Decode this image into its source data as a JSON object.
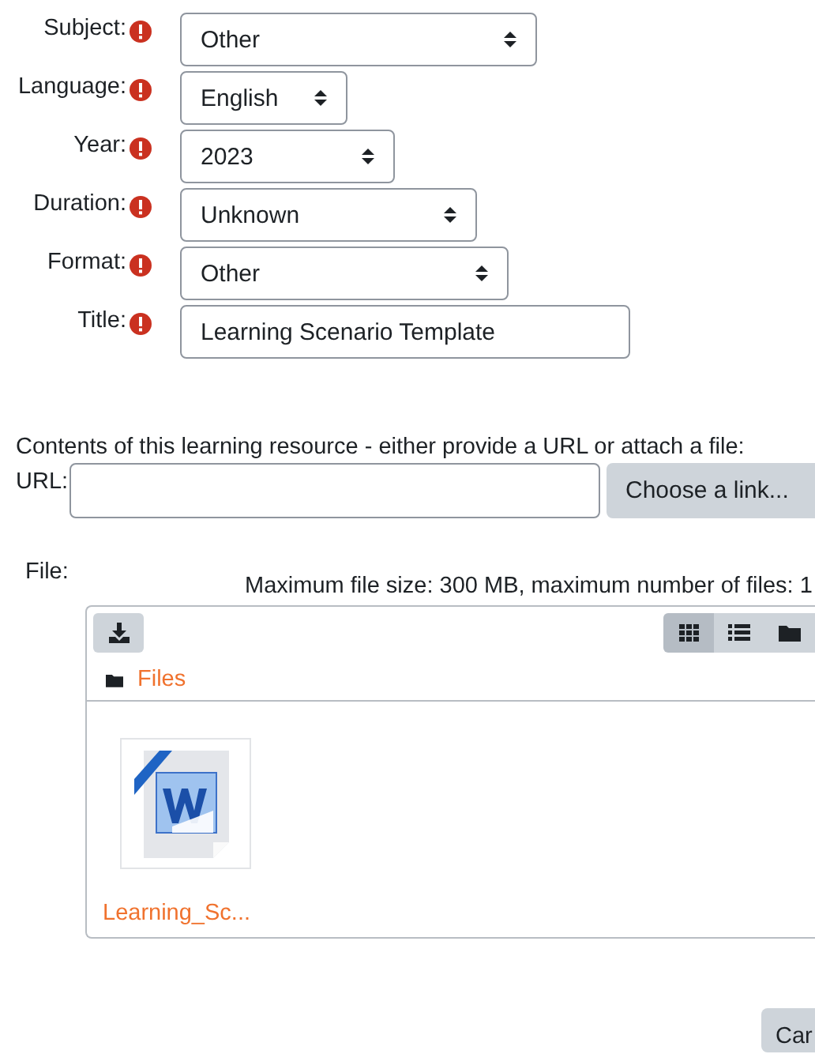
{
  "fields": [
    {
      "label": "Subject:",
      "required": true,
      "kind": "select",
      "value": "Other"
    },
    {
      "label": "Language:",
      "required": true,
      "kind": "select",
      "value": "English"
    },
    {
      "label": "Year:",
      "required": true,
      "kind": "select",
      "value": "2023"
    },
    {
      "label": "Duration:",
      "required": true,
      "kind": "select",
      "value": "Unknown"
    },
    {
      "label": "Format:",
      "required": true,
      "kind": "select",
      "value": "Other"
    },
    {
      "label": "Title:",
      "required": true,
      "kind": "text",
      "value": "Learning Scenario Template"
    }
  ],
  "contents": {
    "intro": "Contents of this learning resource - either provide a URL or attach a file:",
    "url_label": "URL:",
    "choose_button": "Choose a link..."
  },
  "file": {
    "label": "File:",
    "limits": "Maximum file size: 300 MB, maximum number of files: 1",
    "view_modes": [
      {
        "kind": "grid",
        "selected": true
      },
      {
        "kind": "list",
        "selected": false
      },
      {
        "kind": "tree",
        "selected": false
      }
    ],
    "path": "Files",
    "items": [
      {
        "name": "Learning_Sc..."
      }
    ]
  },
  "buttons": [
    "Car"
  ]
}
